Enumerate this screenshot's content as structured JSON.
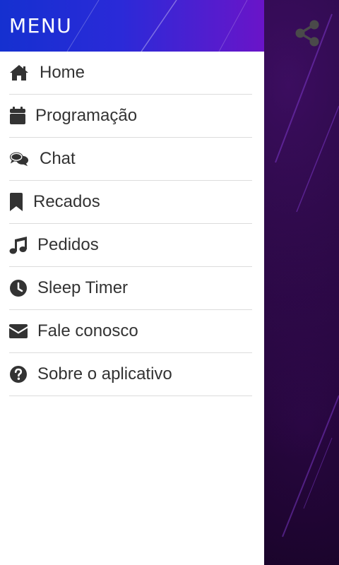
{
  "header": {
    "title": "MENU"
  },
  "menu": {
    "items": [
      {
        "label": "Home",
        "icon": "home-icon"
      },
      {
        "label": "Programação",
        "icon": "calendar-icon"
      },
      {
        "label": "Chat",
        "icon": "chat-icon"
      },
      {
        "label": "Recados",
        "icon": "bookmark-icon"
      },
      {
        "label": "Pedidos",
        "icon": "music-note-icon"
      },
      {
        "label": "Sleep Timer",
        "icon": "clock-icon"
      },
      {
        "label": "Fale conosco",
        "icon": "envelope-icon"
      },
      {
        "label": "Sobre o aplicativo",
        "icon": "question-circle-icon"
      }
    ]
  },
  "toolbar": {
    "share_icon": "share-icon"
  },
  "colors": {
    "header_gradient_start": "#1530d0",
    "header_gradient_end": "#6a14c8",
    "background": "#0d0418",
    "menu_text": "#333333",
    "divider": "#dcdcdc",
    "share_icon": "#4a4a4a"
  }
}
